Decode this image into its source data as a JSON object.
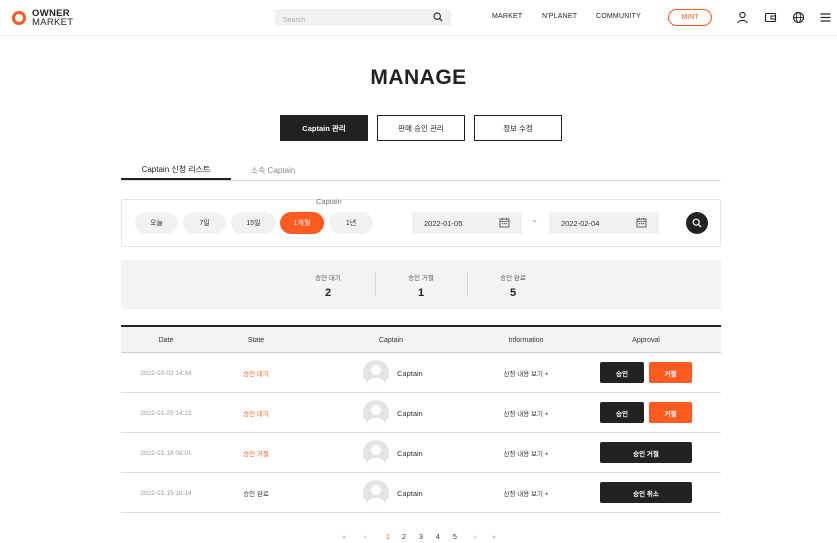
{
  "header": {
    "logo_line1": "OWNER",
    "logo_line2": "MARKET",
    "search_placeholder": "Search",
    "nav": [
      "MARKET",
      "N'PLANET",
      "COMMUNITY"
    ],
    "mint_label": "MINT",
    "icons": [
      "user-icon",
      "wallet-icon",
      "globe-icon",
      "menu-icon"
    ]
  },
  "page_title": "MANAGE",
  "main_tabs": [
    "Captain 관리",
    "판매 승인 관리",
    "정보 수정"
  ],
  "main_tabs_active": 0,
  "sub_tabs": [
    "Captain 신청 리스트",
    "소속 Captain"
  ],
  "sub_tabs_active": 0,
  "filter": {
    "section_label": "Captain",
    "periods": [
      "오늘",
      "7일",
      "15일",
      "1개월",
      "1년"
    ],
    "active_period": "1개월",
    "date_from": "2022-01-05",
    "date_to": "2022-02-04",
    "separator": "~"
  },
  "stats": [
    {
      "label": "승인 대기",
      "value": "2"
    },
    {
      "label": "승인 거절",
      "value": "1"
    },
    {
      "label": "승인 완료",
      "value": "5"
    }
  ],
  "table": {
    "columns": [
      "Date",
      "State",
      "Captain",
      "Information",
      "Approval"
    ],
    "rows": [
      {
        "date": "2022-02-03 14:34",
        "state": "승인 대기",
        "captain": "Captain",
        "info": "신청 내용 보기 +",
        "actions": [
          "승인",
          "거절"
        ]
      },
      {
        "date": "2022-01-25 14:23",
        "state": "승인 대기",
        "captain": "Captain",
        "info": "신청 내용 보기 +",
        "actions": [
          "승인",
          "거절"
        ]
      },
      {
        "date": "2022-01-18 09:01",
        "state": "승인 거절",
        "captain": "Captain",
        "info": "신청 내용 보기 +",
        "actions": [
          "승인 거절"
        ]
      },
      {
        "date": "2022-01-15 16:14",
        "state": "승인 완료",
        "captain": "Captain",
        "info": "신청 내용 보기 +",
        "actions": [
          "승인 취소"
        ]
      }
    ]
  },
  "pagination": {
    "first": "«",
    "prev": "‹",
    "pages": [
      "1",
      "2",
      "3",
      "4",
      "5"
    ],
    "current": "1",
    "next": "›",
    "last": "»"
  },
  "colors": {
    "accent": "#ff5a1f",
    "dark": "#222222",
    "panel": "#f3f3f3"
  }
}
